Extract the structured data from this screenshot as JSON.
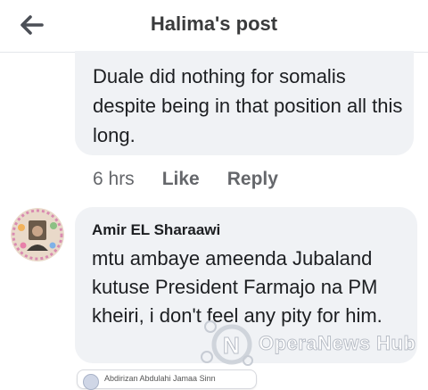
{
  "header": {
    "title": "Halima's post",
    "back_icon": "arrow-left-icon"
  },
  "comment1": {
    "text": "Duale did nothing for somalis despite being in that position all this long.",
    "time": "6 hrs",
    "like_label": "Like",
    "reply_label": "Reply"
  },
  "comment2": {
    "author": "Amir EL Sharaawi",
    "text": "mtu ambaye ameenda Jubaland kutuse President Farmajo na PM kheiri, i don't feel any pity for him.",
    "avatar_icon": "user-avatar"
  },
  "comment3_preview": {
    "author": "Abdirizan Abdulahi Jamaa Sinn"
  },
  "watermark": {
    "text": "OperaNews Hub"
  },
  "colors": {
    "bubble": "#f0f2f5",
    "meta_text": "#65676b",
    "title_text": "#3a3b3c"
  }
}
